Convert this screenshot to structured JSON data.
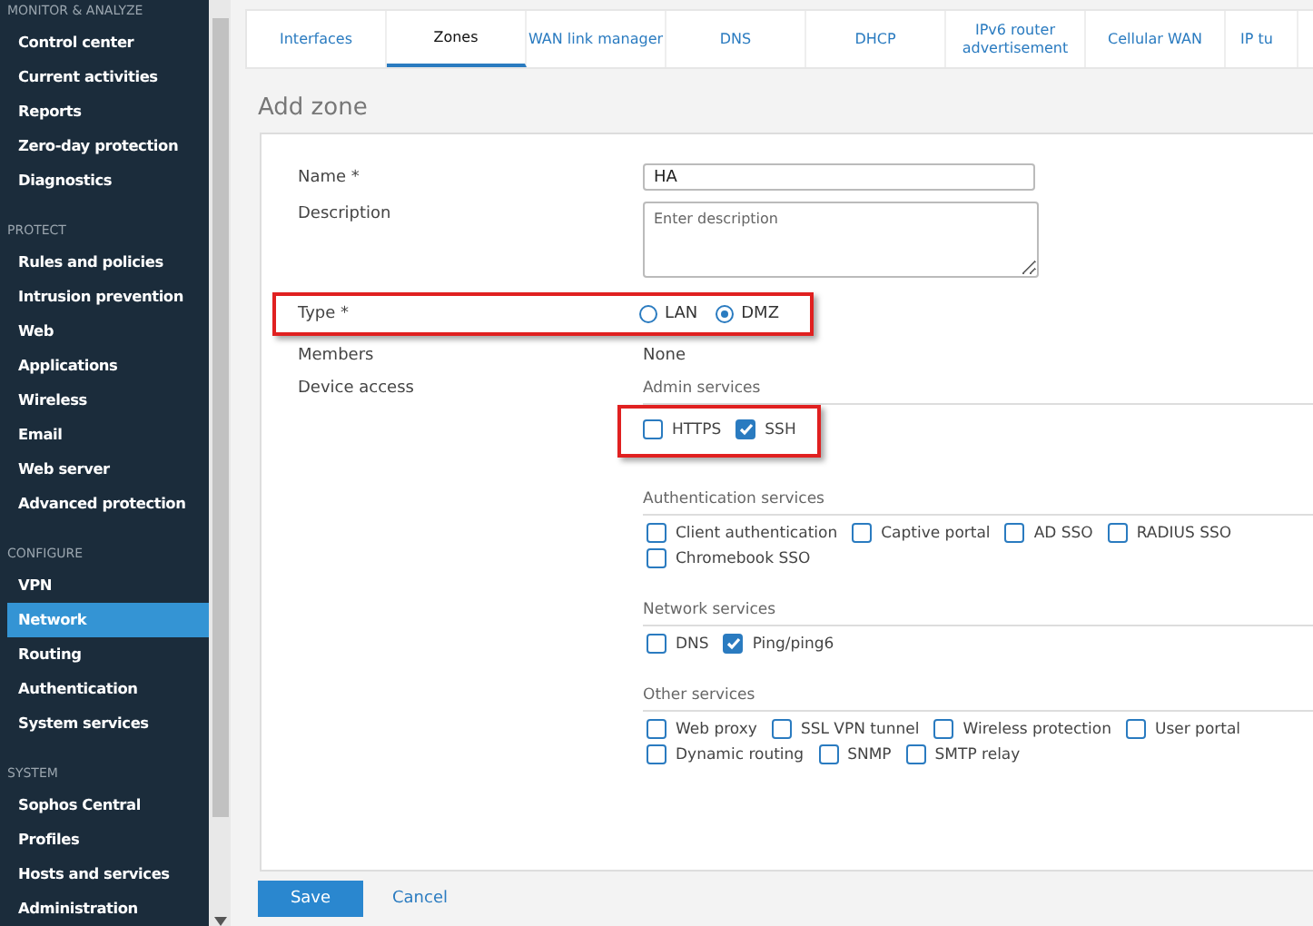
{
  "sidebar": {
    "groups": [
      {
        "heading": "MONITOR & ANALYZE",
        "items": [
          {
            "label": "Control center",
            "selected": false
          },
          {
            "label": "Current activities",
            "selected": false
          },
          {
            "label": "Reports",
            "selected": false
          },
          {
            "label": "Zero-day protection",
            "selected": false
          },
          {
            "label": "Diagnostics",
            "selected": false
          }
        ]
      },
      {
        "heading": "PROTECT",
        "items": [
          {
            "label": "Rules and policies",
            "selected": false
          },
          {
            "label": "Intrusion prevention",
            "selected": false
          },
          {
            "label": "Web",
            "selected": false
          },
          {
            "label": "Applications",
            "selected": false
          },
          {
            "label": "Wireless",
            "selected": false
          },
          {
            "label": "Email",
            "selected": false
          },
          {
            "label": "Web server",
            "selected": false
          },
          {
            "label": "Advanced protection",
            "selected": false
          }
        ]
      },
      {
        "heading": "CONFIGURE",
        "items": [
          {
            "label": "VPN",
            "selected": false
          },
          {
            "label": "Network",
            "selected": true
          },
          {
            "label": "Routing",
            "selected": false
          },
          {
            "label": "Authentication",
            "selected": false
          },
          {
            "label": "System services",
            "selected": false
          }
        ]
      },
      {
        "heading": "SYSTEM",
        "items": [
          {
            "label": "Sophos Central",
            "selected": false
          },
          {
            "label": "Profiles",
            "selected": false
          },
          {
            "label": "Hosts and services",
            "selected": false
          },
          {
            "label": "Administration",
            "selected": false
          }
        ]
      }
    ]
  },
  "tabs": [
    {
      "label": "Interfaces",
      "selected": false
    },
    {
      "label": "Zones",
      "selected": true
    },
    {
      "label": "WAN link manager",
      "selected": false
    },
    {
      "label": "DNS",
      "selected": false
    },
    {
      "label": "DHCP",
      "selected": false
    },
    {
      "label": "IPv6 router advertisement",
      "selected": false
    },
    {
      "label": "Cellular WAN",
      "selected": false
    },
    {
      "label": "IP tu",
      "selected": false
    }
  ],
  "page_title": "Add zone",
  "form": {
    "name": {
      "label": "Name *",
      "value": "HA"
    },
    "description": {
      "label": "Description",
      "placeholder": "Enter description"
    },
    "type": {
      "label": "Type *",
      "highlighted": true,
      "options": [
        {
          "label": "LAN",
          "selected": false
        },
        {
          "label": "DMZ",
          "selected": true
        }
      ]
    },
    "members": {
      "label": "Members",
      "value": "None"
    },
    "device_access": {
      "label": "Device access",
      "sections": [
        {
          "title": "Admin services",
          "highlighted": true,
          "items": [
            {
              "label": "HTTPS",
              "checked": false
            },
            {
              "label": "SSH",
              "checked": true
            }
          ]
        },
        {
          "title": "Authentication services",
          "highlighted": false,
          "items": [
            {
              "label": "Client authentication",
              "checked": false
            },
            {
              "label": "Captive portal",
              "checked": false
            },
            {
              "label": "AD SSO",
              "checked": false
            },
            {
              "label": "RADIUS SSO",
              "checked": false
            },
            {
              "label": "Chromebook SSO",
              "checked": false
            }
          ]
        },
        {
          "title": "Network services",
          "highlighted": false,
          "items": [
            {
              "label": "DNS",
              "checked": false
            },
            {
              "label": "Ping/ping6",
              "checked": true
            }
          ]
        },
        {
          "title": "Other services",
          "highlighted": false,
          "items": [
            {
              "label": "Web proxy",
              "checked": false
            },
            {
              "label": "SSL VPN tunnel",
              "checked": false
            },
            {
              "label": "Wireless protection",
              "checked": false
            },
            {
              "label": "User portal",
              "checked": false
            },
            {
              "label": "Dynamic routing",
              "checked": false
            },
            {
              "label": "SNMP",
              "checked": false
            },
            {
              "label": "SMTP relay",
              "checked": false
            }
          ]
        }
      ]
    }
  },
  "buttons": {
    "save": "Save",
    "cancel": "Cancel"
  }
}
